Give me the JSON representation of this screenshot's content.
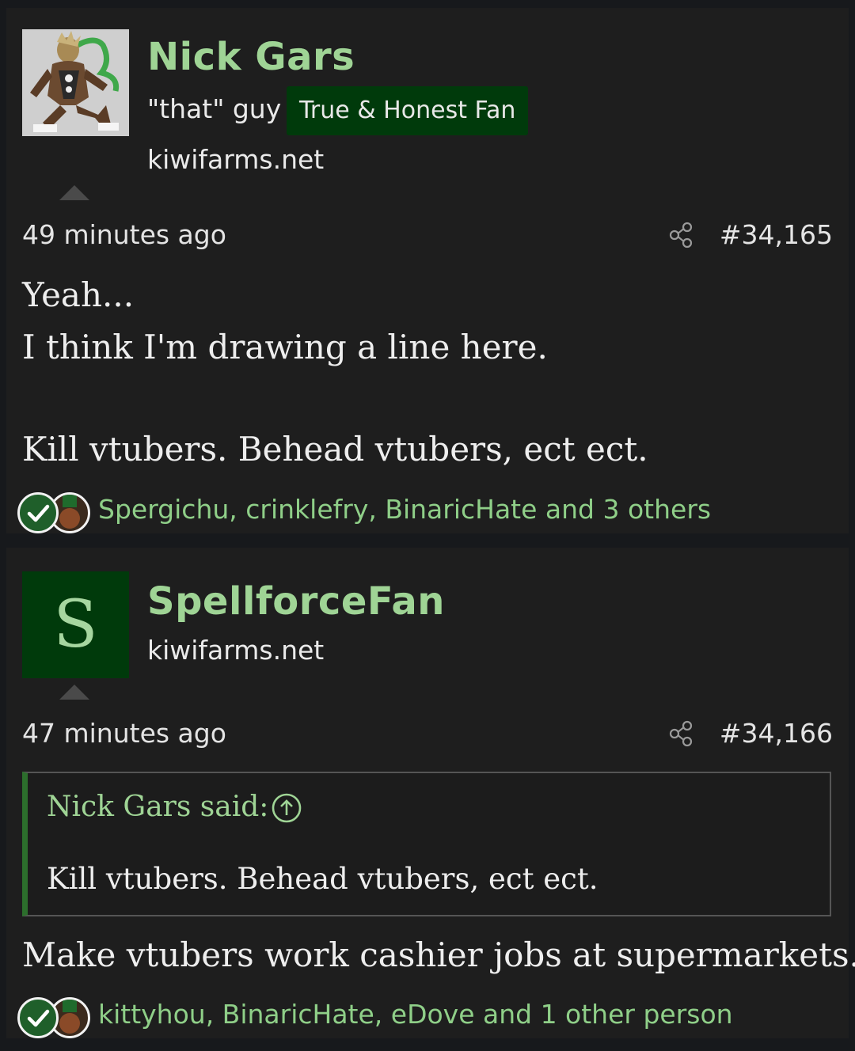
{
  "posts": [
    {
      "username": "Nick Gars",
      "user_title": "\"that\" guy",
      "banner": "True & Honest Fan",
      "site": "kiwifarms.net",
      "time": "49 minutes ago",
      "post_number": "#34,165",
      "body_lines": [
        "Yeah...",
        "I think I'm drawing a line here.",
        "Kill vtubers. Behead vtubers, ect ect."
      ],
      "reactions": "Spergichu, crinklefry, BinaricHate and 3 others"
    },
    {
      "username": "SpellforceFan",
      "avatar_letter": "S",
      "site": "kiwifarms.net",
      "time": "47 minutes ago",
      "post_number": "#34,166",
      "quote": {
        "author": "Nick Gars said:",
        "text": "Kill vtubers. Behead vtubers, ect ect."
      },
      "body_lines": [
        "Make vtubers work cashier jobs at supermarkets."
      ],
      "reactions": "kittyhou, BinaricHate, eDove and 1 other person"
    }
  ],
  "icons": {
    "share": "share-icon",
    "quote_jump": "arrow-up-circle-icon",
    "reaction_1": "check-reaction-icon",
    "reaction_2": "medal-reaction-icon"
  },
  "colors": {
    "username": "#9fd495",
    "banner_bg": "#003a0b",
    "reaction_text": "#8fcf88",
    "quote_border": "#2c6e2c"
  }
}
